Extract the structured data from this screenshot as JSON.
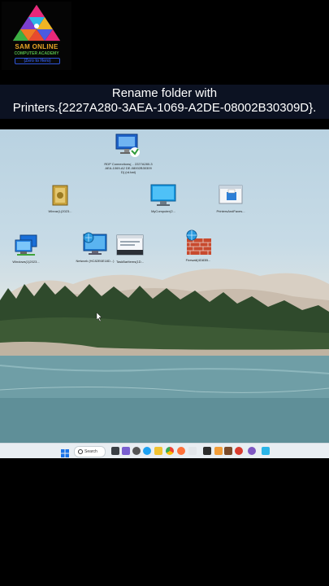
{
  "logo": {
    "name": "SAM ONLINE",
    "subtitle": "COMPUTER ACADEMY",
    "tagline": "(Zero to Hero)"
  },
  "caption": {
    "line1": "Rename folder with",
    "line2": "Printers.{2227A280-3AEA-1069-A2DE-08002B30309D}."
  },
  "desktop": {
    "icons": [
      {
        "label": "RDP Connections(... 2227A280-3AEA-1069-A2 DE-08002B30309D} (rd.bat)"
      },
      {
        "label": "Winrar(L)2023..."
      },
      {
        "label": "MyComputer(2..."
      },
      {
        "label": "PrintersAndFaxes..."
      },
      {
        "label": "Windows(1)2023..."
      },
      {
        "label": "Network (HC82E6E18D...)"
      },
      {
        "label": "TaskBarItems(1D..."
      },
      {
        "label": "Firewall(4D83B..."
      }
    ]
  },
  "taskbar": {
    "search_label": "Search",
    "colors": {
      "bg": "#e9eef2",
      "start": "#1a73e8"
    }
  }
}
